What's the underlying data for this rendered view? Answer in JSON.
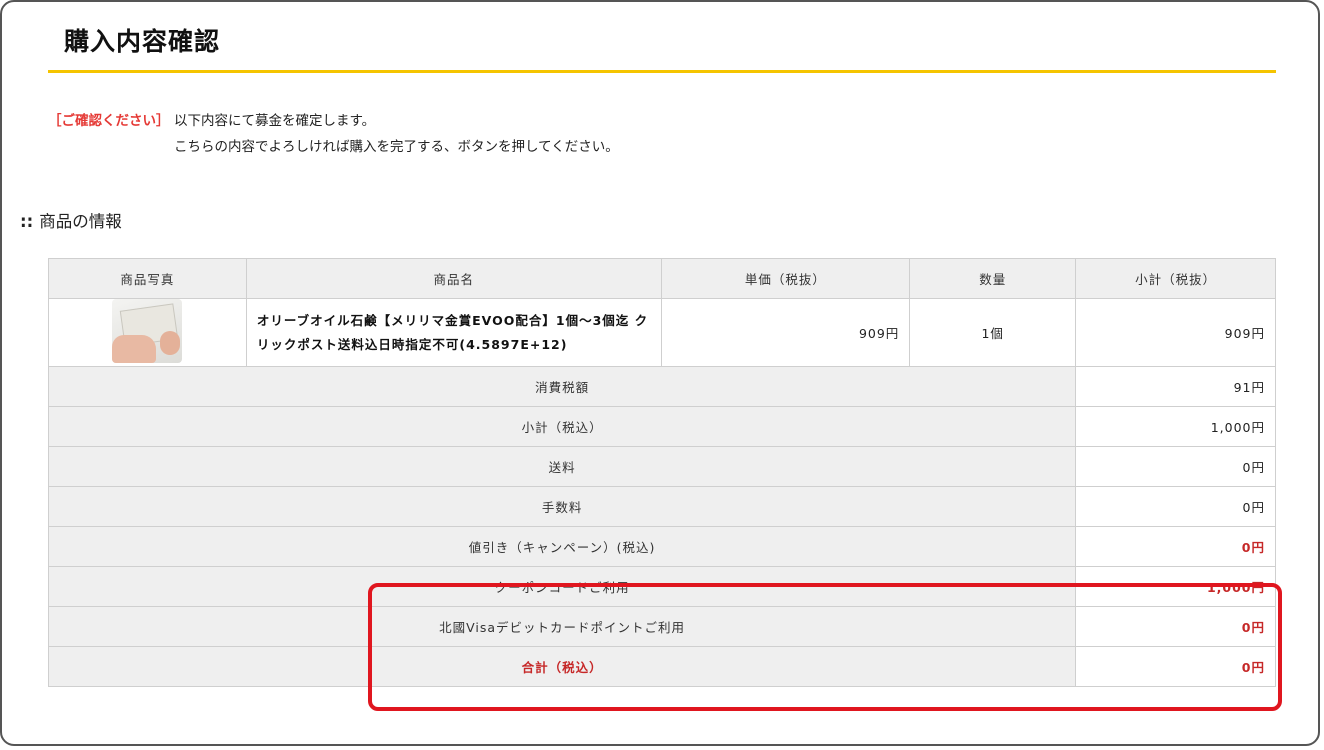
{
  "page": {
    "title": "購入内容確認"
  },
  "notice": {
    "tag": "［ご確認ください］",
    "line1": "以下内容にて募金を確定します。",
    "line2": "こちらの内容でよろしければ購入を完了する、ボタンを押してください。"
  },
  "section": {
    "dots": "::",
    "title": "商品の情報"
  },
  "table": {
    "headers": {
      "photo": "商品写真",
      "name": "商品名",
      "price": "単価（税抜）",
      "qty": "数量",
      "subtotal": "小計（税抜）"
    },
    "product": {
      "name": "オリーブオイル石鹸【メリリマ金賞EVOO配合】1個～3個迄 クリックポスト送料込日時指定不可(4.5897E+12)",
      "price": "909円",
      "qty": "1個",
      "subtotal": "909円"
    },
    "summary": [
      {
        "label": "消費税額",
        "value": "91円"
      },
      {
        "label": "小計（税込）",
        "value": "1,000円"
      },
      {
        "label": "送料",
        "value": "0円"
      },
      {
        "label": "手数料",
        "value": "0円"
      },
      {
        "label": "値引き（キャンペーン）(税込)",
        "value": "0円"
      },
      {
        "label": "クーポンコードご利用",
        "value": "1,000円"
      },
      {
        "label": "北國Visaデビットカードポイントご利用",
        "value": "0円"
      },
      {
        "label": "合計（税込）",
        "value": "0円"
      }
    ]
  },
  "colors": {
    "accent": "#f5c400",
    "alert": "#e53935",
    "highlight": "#e0161f"
  }
}
